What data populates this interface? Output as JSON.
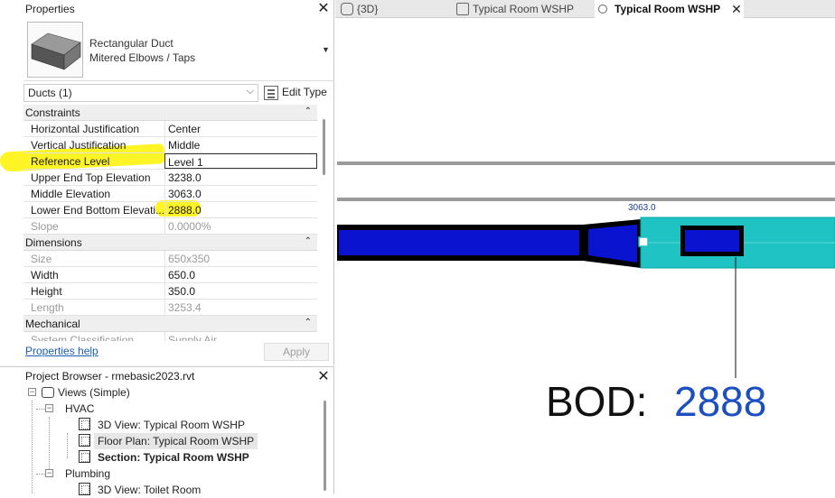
{
  "properties": {
    "title": "Properties",
    "type_name_line1": "Rectangular Duct",
    "type_name_line2": "Mitered Elbows / Taps",
    "filter": "Ducts (1)",
    "edit_type": "Edit Type",
    "rows": [
      {
        "kind": "cat",
        "label": "Constraints"
      },
      {
        "kind": "param",
        "label": "Horizontal Justification",
        "value": "Center"
      },
      {
        "kind": "param",
        "label": "Vertical Justification",
        "value": "Middle"
      },
      {
        "kind": "param",
        "label": "Reference Level",
        "value": "Level 1",
        "editing": true
      },
      {
        "kind": "param",
        "label": "Upper End Top Elevation",
        "value": "3238.0"
      },
      {
        "kind": "param",
        "label": "Middle Elevation",
        "value": "3063.0"
      },
      {
        "kind": "param",
        "label": "Lower End Bottom Elevati...",
        "value": "2888.0"
      },
      {
        "kind": "param",
        "label": "Slope",
        "value": "0.0000%",
        "readonly": true
      },
      {
        "kind": "cat",
        "label": "Dimensions"
      },
      {
        "kind": "param",
        "label": "Size",
        "value": "650x350",
        "readonly": true
      },
      {
        "kind": "param",
        "label": "Width",
        "value": "650.0"
      },
      {
        "kind": "param",
        "label": "Height",
        "value": "350.0"
      },
      {
        "kind": "param",
        "label": "Length",
        "value": "3253.4",
        "readonly": true
      },
      {
        "kind": "cat",
        "label": "Mechanical"
      },
      {
        "kind": "param",
        "label": "System Classification",
        "value": "Supply Air",
        "readonly": true
      }
    ],
    "help_link": "Properties help",
    "apply": "Apply"
  },
  "browser": {
    "title": "Project Browser - rmebasic2023.rvt",
    "views_root": "Views (Simple)",
    "hvac": "HVAC",
    "hvac_items": [
      "3D View: Typical Room WSHP",
      "Floor Plan: Typical Room WSHP",
      "Section: Typical Room WSHP"
    ],
    "plumbing": "Plumbing",
    "plumbing_items": [
      "3D View: Toilet Room"
    ]
  },
  "tabs": [
    {
      "label": "{3D}"
    },
    {
      "label": "Typical Room WSHP"
    },
    {
      "label": "Typical Room WSHP",
      "active": true
    }
  ],
  "canvas": {
    "elevation_tag": "3063.0",
    "bod_label": "BOD:",
    "bod_value": "2888",
    "colors": {
      "duct_blue": "#0a14d0",
      "duct_cyan": "#1fc3c3",
      "highlight": "#fff200",
      "annotation_blue": "#1e4fbf"
    }
  }
}
